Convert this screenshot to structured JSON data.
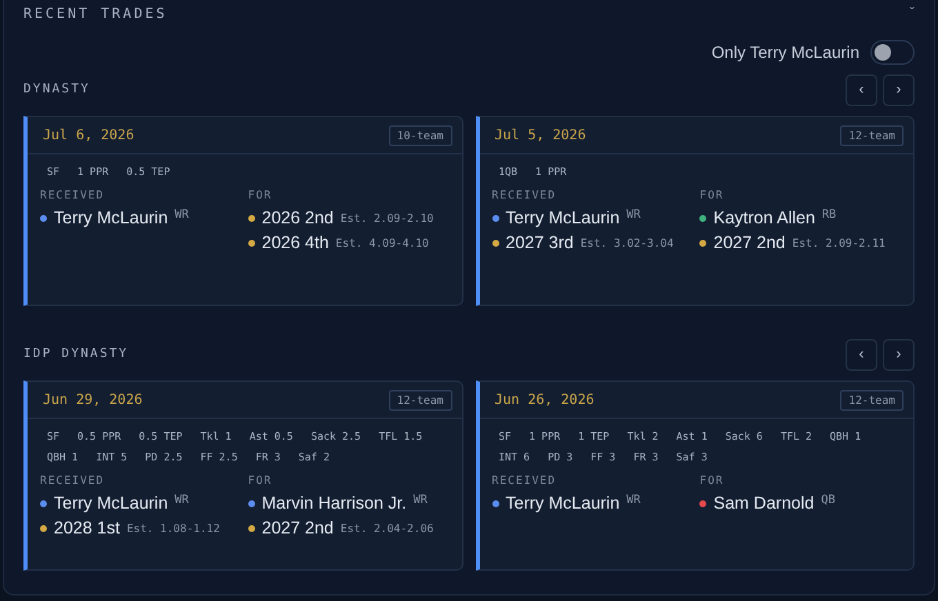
{
  "panel": {
    "title": "RECENT TRADES",
    "collapse_icon": "ˇ"
  },
  "filter": {
    "label": "Only Terry McLaurin",
    "on": false
  },
  "sections": [
    {
      "title": "DYNASTY",
      "nav": [
        "‹",
        "›"
      ],
      "trades": [
        {
          "date": "Jul 6, 2026",
          "league": "10-team",
          "settings": [
            "SF",
            "1 PPR",
            "0.5 TEP"
          ],
          "received_label": "RECEIVED",
          "for_label": "FOR",
          "received": [
            {
              "kind": "player",
              "name": "Terry McLaurin",
              "detail": "WR",
              "color": "#5b8def"
            }
          ],
          "for": [
            {
              "kind": "pick",
              "name": "2026 2nd",
              "detail": "Est. 2.09-2.10",
              "color": "#d4a843"
            },
            {
              "kind": "pick",
              "name": "2026 4th",
              "detail": "Est. 4.09-4.10",
              "color": "#d4a843"
            }
          ]
        },
        {
          "date": "Jul 5, 2026",
          "league": "12-team",
          "settings": [
            "1QB",
            "1 PPR"
          ],
          "received_label": "RECEIVED",
          "for_label": "FOR",
          "received": [
            {
              "kind": "player",
              "name": "Terry McLaurin",
              "detail": "WR",
              "color": "#5b8def"
            },
            {
              "kind": "pick",
              "name": "2027 3rd",
              "detail": "Est. 3.02-3.04",
              "color": "#d4a843"
            }
          ],
          "for": [
            {
              "kind": "player",
              "name": "Kaytron Allen",
              "detail": "RB",
              "color": "#3fb27f"
            },
            {
              "kind": "pick",
              "name": "2027 2nd",
              "detail": "Est. 2.09-2.11",
              "color": "#d4a843"
            }
          ]
        }
      ]
    },
    {
      "title": "IDP DYNASTY",
      "nav": [
        "‹",
        "›"
      ],
      "trades": [
        {
          "date": "Jun 29, 2026",
          "league": "12-team",
          "settings": [
            "SF",
            "0.5 PPR",
            "0.5 TEP",
            "Tkl 1",
            "Ast 0.5",
            "Sack 2.5",
            "TFL 1.5",
            "QBH 1",
            "INT 5",
            "PD 2.5",
            "FF 2.5",
            "FR 3",
            "Saf 2"
          ],
          "received_label": "RECEIVED",
          "for_label": "FOR",
          "received": [
            {
              "kind": "player",
              "name": "Terry McLaurin",
              "detail": "WR",
              "color": "#5b8def"
            },
            {
              "kind": "pick",
              "name": "2028 1st",
              "detail": "Est. 1.08-1.12",
              "color": "#d4a843"
            }
          ],
          "for": [
            {
              "kind": "player",
              "name": "Marvin Harrison Jr.",
              "detail": "WR",
              "color": "#5b8def"
            },
            {
              "kind": "pick",
              "name": "2027 2nd",
              "detail": "Est. 2.04-2.06",
              "color": "#d4a843"
            }
          ]
        },
        {
          "date": "Jun 26, 2026",
          "league": "12-team",
          "settings": [
            "SF",
            "1 PPR",
            "1 TEP",
            "Tkl 2",
            "Ast 1",
            "Sack 6",
            "TFL 2",
            "QBH 1",
            "INT 6",
            "PD 3",
            "FF 3",
            "FR 3",
            "Saf 3"
          ],
          "received_label": "RECEIVED",
          "for_label": "FOR",
          "received": [
            {
              "kind": "player",
              "name": "Terry McLaurin",
              "detail": "WR",
              "color": "#5b8def"
            }
          ],
          "for": [
            {
              "kind": "player",
              "name": "Sam Darnold",
              "detail": "QB",
              "color": "#e5484d"
            }
          ]
        }
      ]
    }
  ]
}
